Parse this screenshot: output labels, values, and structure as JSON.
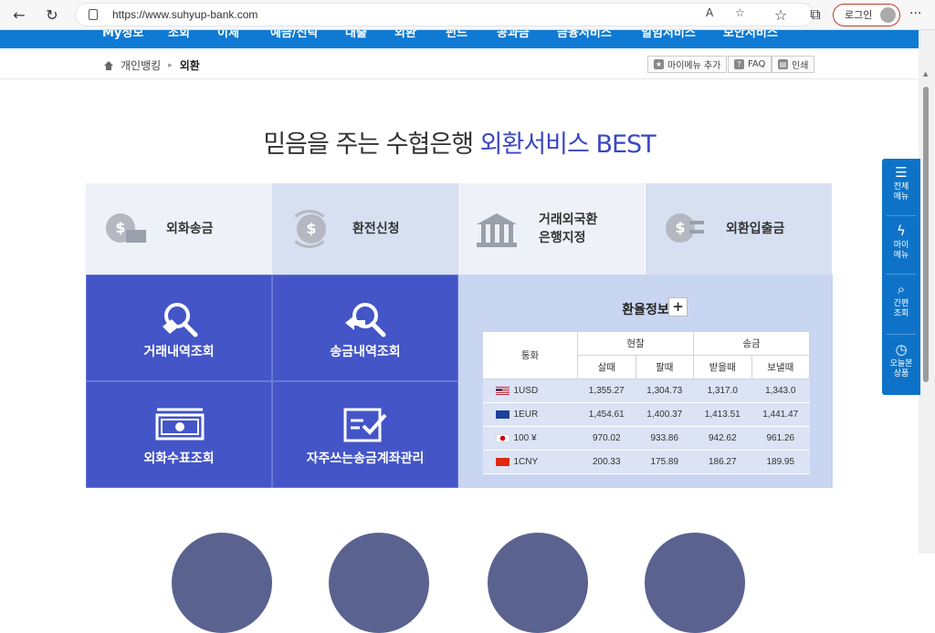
{
  "browser": {
    "url": "https://www.suhyup-bank.com",
    "login_label": "로그인"
  },
  "gnb": [
    "My정보",
    "조회",
    "이체",
    "예금/신탁",
    "대출",
    "외환",
    "펀드",
    "공과금",
    "금융서비스",
    "일임서비스",
    "보안서비스"
  ],
  "breadcrumb": {
    "home": "개인뱅킹",
    "current": "외환"
  },
  "tools": {
    "my_menu": "마이메뉴 추가",
    "faq": "FAQ",
    "print": "인쇄"
  },
  "headline": {
    "prefix": "믿음을 주는 수협은행 ",
    "highlight": "외환서비스 BEST"
  },
  "top_tiles": [
    {
      "label": "외화송금",
      "icon": "remittance-coin-icon"
    },
    {
      "label": "환전신청",
      "icon": "exchange-cycle-icon"
    },
    {
      "label_line1": "거래외국환",
      "label_line2": "은행지정",
      "icon": "bank-building-icon"
    },
    {
      "label": "외환입출금",
      "icon": "deposit-withdraw-icon"
    }
  ],
  "blue_tiles": [
    {
      "label": "거래내역조회",
      "icon": "magnifier-check-icon"
    },
    {
      "label": "송금내역조회",
      "icon": "magnifier-arrow-icon"
    },
    {
      "label": "외화수표조회",
      "icon": "banknote-icon"
    },
    {
      "label": "자주쓰는송금계좌관리",
      "icon": "card-check-icon"
    }
  ],
  "rates": {
    "title": "환율정보",
    "plus": "+",
    "headers": {
      "currency": "통화",
      "cash": "현찰",
      "remit": "송금",
      "buy": "살때",
      "sell": "팔때",
      "receive": "받을때",
      "send": "보낼때"
    },
    "rows": [
      {
        "currency": "1USD",
        "flag": "us",
        "buy": "1,355.27",
        "sell": "1,304.73",
        "receive": "1,317.0",
        "send": "1,343.0"
      },
      {
        "currency": "1EUR",
        "flag": "eu",
        "buy": "1,454.61",
        "sell": "1,400.37",
        "receive": "1,413.51",
        "send": "1,441.47"
      },
      {
        "currency": "100 ¥",
        "flag": "jp",
        "buy": "970.02",
        "sell": "933.86",
        "receive": "942.62",
        "send": "961.26"
      },
      {
        "currency": "1CNY",
        "flag": "cn",
        "buy": "200.33",
        "sell": "175.89",
        "receive": "186.27",
        "send": "189.95"
      }
    ]
  },
  "quick_menu": [
    {
      "line1": "전체",
      "line2": "메뉴",
      "icon": "hamburger-icon"
    },
    {
      "line1": "마이",
      "line2": "메뉴",
      "icon": "lightning-icon"
    },
    {
      "line1": "간편",
      "line2": "조회",
      "icon": "search-icon"
    },
    {
      "line1": "오늘본",
      "line2": "상품",
      "icon": "clock-icon"
    }
  ]
}
